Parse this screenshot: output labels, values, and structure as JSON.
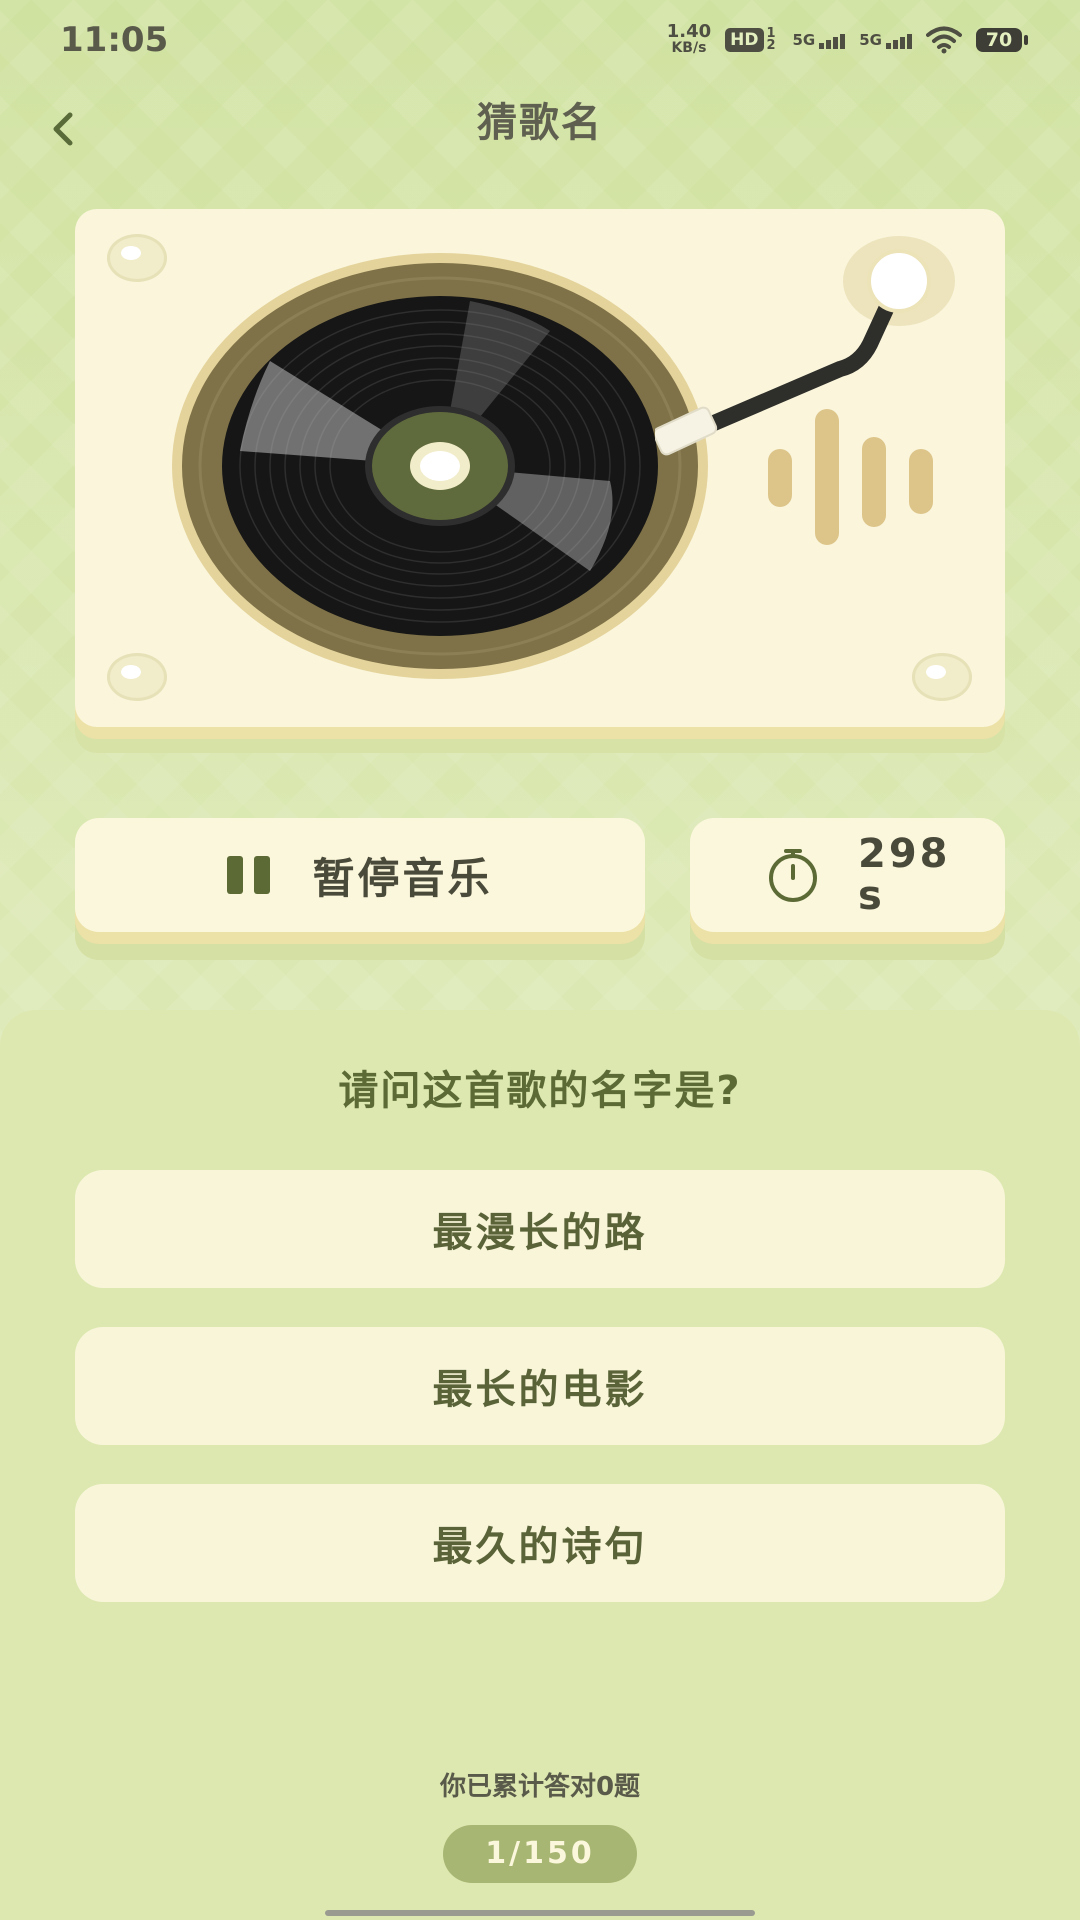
{
  "status_bar": {
    "time": "11:05",
    "net_speed_value": "1.40",
    "net_speed_unit": "KB/s",
    "hd_label": "HD",
    "hd_sub": "1 2",
    "signal1_label": "5G",
    "signal2_label": "5G",
    "battery": "70"
  },
  "header": {
    "title": "猜歌名",
    "back_icon": "chevron-left-icon"
  },
  "player": {
    "pause_label": "暂停音乐",
    "timer_value": "298 s",
    "colors": {
      "card": "#faf5db",
      "label_outer": "#8a7c52",
      "label_inner": "#5f6b3c",
      "accent": "#5c6b36"
    }
  },
  "quiz": {
    "question": "请问这首歌的名字是?",
    "options": [
      {
        "label": "最漫长的路"
      },
      {
        "label": "最长的电影"
      },
      {
        "label": "最久的诗句"
      }
    ],
    "score_text": "你已累计答对0题",
    "progress": "1/150"
  }
}
